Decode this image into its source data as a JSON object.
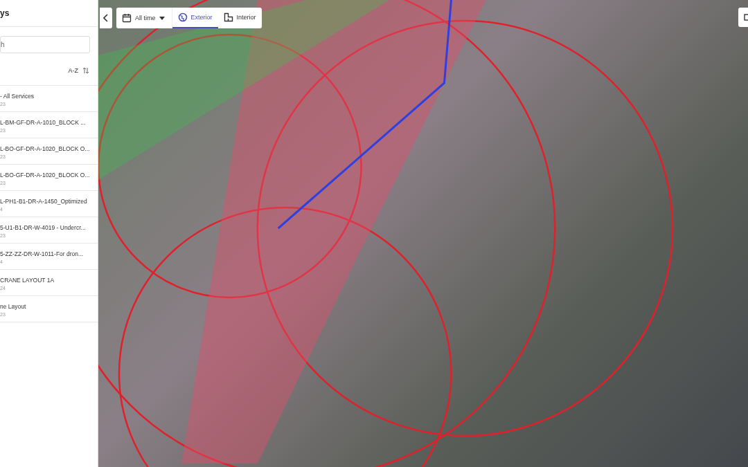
{
  "sidebar": {
    "title": "ys",
    "search": {
      "placeholder": "h"
    },
    "sort_label": "A-Z",
    "items": [
      {
        "name": "- All Services",
        "date": "23"
      },
      {
        "name": "L-BM-GF-DR-A-1010_BLOCK ...",
        "date": "23"
      },
      {
        "name": "L-BO-GF-DR-A-1020_BLOCK O...",
        "date": "23"
      },
      {
        "name": "L-BO-GF-DR-A-1020_BLOCK O...",
        "date": "23"
      },
      {
        "name": "L-PH1-B1-DR-A-1450_Optimized",
        "date": "4"
      },
      {
        "name": "5-U1-B1-DR-W-4019 - Undercr...",
        "date": "23"
      },
      {
        "name": "5-ZZ-ZZ-DR-W-1011-For dron...",
        "date": "4"
      },
      {
        "name": "CRANE LAYOUT 1A",
        "date": "24"
      },
      {
        "name": "ne Layout",
        "date": "23"
      }
    ]
  },
  "toolbar": {
    "date_filter": "All time",
    "tabs": [
      {
        "label": "Exterior",
        "selected": true
      },
      {
        "label": "Interior",
        "selected": false
      }
    ]
  }
}
